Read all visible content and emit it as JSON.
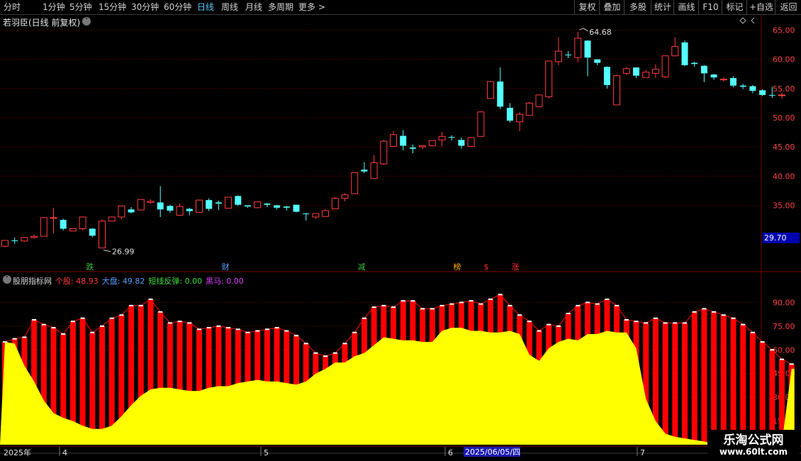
{
  "toolbar": {
    "periods": [
      {
        "label": "分时",
        "active": false
      },
      {
        "label": "1分钟",
        "active": false
      },
      {
        "label": "5分钟",
        "active": false
      },
      {
        "label": "15分钟",
        "active": false
      },
      {
        "label": "30分钟",
        "active": false
      },
      {
        "label": "60分钟",
        "active": false
      },
      {
        "label": "日线",
        "active": true
      },
      {
        "label": "周线",
        "active": false
      },
      {
        "label": "月线",
        "active": false
      },
      {
        "label": "多周期",
        "active": false
      },
      {
        "label": "更多 >",
        "active": false
      }
    ],
    "right_buttons": [
      "复权",
      "叠加",
      "多股",
      "统计",
      "画线",
      "F10",
      "标记",
      "+自选",
      "返回"
    ]
  },
  "main": {
    "title": "若羽臣(日线 前复权)",
    "high_label": "64.68",
    "low_label": "26.99",
    "current_price": "29.70",
    "price_axis": [
      "65.00",
      "60.00",
      "55.00",
      "50.00",
      "45.00",
      "40.00",
      "35.00"
    ]
  },
  "badges": [
    {
      "text": "跌",
      "color": "#3fbf3f"
    },
    {
      "text": "财",
      "color": "#5aa0ff"
    },
    {
      "text": "减",
      "color": "#3fbf3f"
    },
    {
      "text": "榜",
      "color": "#ffaa00"
    },
    {
      "text": "$",
      "color": "#ff3030"
    },
    {
      "text": "涨",
      "color": "#ff3030"
    }
  ],
  "indicator": {
    "name": "股朋指标网",
    "stock_label": "个股: ",
    "stock_value": "48.93",
    "market_label": "大盘: ",
    "market_value": "49.82",
    "rebound_label": "短线反弹: ",
    "rebound_value": "0.00",
    "darkhorse_label": "黑马: ",
    "darkhorse_value": "0.00",
    "axis": [
      "90.00",
      "75.00",
      "60.00",
      "45.00",
      "30.00",
      "15.00"
    ]
  },
  "date_axis": {
    "year": "2025年",
    "months": [
      "4",
      "5",
      "6",
      "7"
    ],
    "cursor_date": "2025/06/05/四"
  },
  "watermark": {
    "line1": "乐淘公式网",
    "line2": "www.60lt.com"
  },
  "colors": {
    "up": "#ff3c3c",
    "down": "#54ffff",
    "yellow": "#ffff00",
    "red": "#ff0000",
    "grid": "#7a0000"
  },
  "chart_data": {
    "type": "candlestick",
    "price_range": [
      24.5,
      67
    ],
    "candles": [
      [
        28.0,
        29.0,
        27.8,
        29.0
      ],
      [
        29.0,
        28.9,
        28.4,
        29.5
      ],
      [
        28.9,
        29.5,
        28.8,
        29.6
      ],
      [
        29.5,
        29.7,
        29.3,
        30.0
      ],
      [
        29.7,
        32.9,
        29.7,
        33.0
      ],
      [
        32.9,
        32.9,
        30.2,
        34.6
      ],
      [
        32.5,
        31.0,
        30.7,
        32.7
      ],
      [
        30.6,
        31.0,
        30.6,
        31.1
      ],
      [
        31.0,
        33.0,
        30.7,
        33.1
      ],
      [
        31.0,
        29.8,
        29.5,
        31.1
      ],
      [
        27.7,
        32.3,
        27.7,
        32.6
      ],
      [
        32.3,
        33.0,
        32.3,
        33.1
      ],
      [
        33.0,
        34.9,
        32.6,
        34.9
      ],
      [
        34.3,
        33.8,
        33.6,
        34.7
      ],
      [
        34.2,
        36.0,
        34.2,
        36.0
      ],
      [
        35.5,
        35.7,
        35.3,
        36.0
      ],
      [
        35.5,
        34.3,
        33.0,
        38.3
      ],
      [
        34.9,
        34.1,
        33.7,
        35.1
      ],
      [
        33.3,
        34.8,
        33.2,
        35.3
      ],
      [
        34.4,
        34.0,
        33.3,
        34.6
      ],
      [
        33.8,
        35.9,
        33.7,
        35.9
      ],
      [
        35.9,
        34.4,
        34.0,
        36.2
      ],
      [
        35.5,
        35.3,
        34.2,
        35.8
      ],
      [
        34.5,
        36.4,
        34.4,
        36.4
      ],
      [
        36.6,
        35.1,
        34.9,
        36.7
      ],
      [
        35.0,
        34.8,
        34.6,
        35.0
      ],
      [
        34.6,
        35.6,
        34.5,
        35.6
      ],
      [
        35.3,
        35.1,
        34.7,
        35.4
      ],
      [
        35.0,
        34.6,
        34.3,
        35.1
      ],
      [
        34.8,
        34.6,
        34.1,
        34.9
      ],
      [
        35.1,
        33.9,
        33.8,
        35.1
      ],
      [
        33.6,
        33.5,
        32.4,
        33.7
      ],
      [
        33.0,
        33.6,
        32.7,
        33.6
      ],
      [
        33.1,
        34.1,
        33.0,
        34.3
      ],
      [
        34.4,
        36.2,
        34.4,
        36.4
      ],
      [
        36.2,
        36.8,
        35.7,
        37.1
      ],
      [
        37.0,
        40.6,
        37.0,
        40.6
      ],
      [
        41.1,
        40.8,
        40.5,
        42.4
      ],
      [
        39.6,
        42.3,
        39.6,
        43.6
      ],
      [
        42.1,
        46.0,
        41.9,
        46.2
      ],
      [
        45.1,
        47.1,
        45.1,
        47.7
      ],
      [
        46.9,
        45.2,
        44.4,
        47.9
      ],
      [
        44.9,
        44.7,
        43.9,
        45.4
      ],
      [
        45.0,
        45.2,
        44.6,
        45.3
      ],
      [
        45.2,
        46.1,
        45.2,
        46.1
      ],
      [
        46.2,
        46.8,
        45.1,
        47.6
      ],
      [
        46.7,
        46.6,
        46.1,
        47.0
      ],
      [
        46.2,
        45.2,
        44.7,
        46.6
      ],
      [
        45.1,
        46.6,
        45.1,
        46.7
      ],
      [
        46.8,
        51.0,
        46.8,
        51.1
      ],
      [
        53.3,
        56.2,
        53.3,
        56.2
      ],
      [
        56.2,
        51.9,
        51.5,
        58.6
      ],
      [
        51.7,
        49.5,
        49.2,
        52.5
      ],
      [
        49.3,
        50.6,
        47.7,
        51.0
      ],
      [
        50.4,
        52.5,
        50.4,
        52.7
      ],
      [
        51.9,
        53.9,
        51.8,
        53.9
      ],
      [
        53.6,
        59.7,
        53.3,
        59.7
      ],
      [
        59.6,
        61.4,
        59.0,
        63.8
      ],
      [
        60.8,
        60.7,
        60.2,
        61.4
      ],
      [
        60.3,
        63.6,
        59.5,
        64.7
      ],
      [
        63.2,
        60.3,
        57.1,
        63.3
      ],
      [
        60.0,
        59.4,
        59.0,
        60.0
      ],
      [
        58.7,
        55.6,
        55.0,
        58.8
      ],
      [
        52.2,
        57.2,
        52.2,
        57.4
      ],
      [
        57.6,
        58.4,
        57.3,
        58.7
      ],
      [
        58.6,
        57.2,
        56.8,
        58.6
      ],
      [
        56.9,
        57.8,
        56.9,
        58.2
      ],
      [
        57.6,
        58.3,
        56.8,
        59.2
      ],
      [
        57.0,
        60.6,
        56.8,
        60.6
      ],
      [
        60.6,
        62.2,
        60.5,
        63.8
      ],
      [
        62.9,
        59.0,
        58.8,
        63.2
      ],
      [
        59.4,
        59.2,
        58.7,
        59.6
      ],
      [
        58.9,
        57.6,
        56.1,
        59.0
      ],
      [
        57.4,
        56.9,
        56.5,
        57.5
      ],
      [
        56.6,
        56.6,
        56.2,
        56.9
      ],
      [
        56.8,
        55.5,
        55.2,
        57.1
      ],
      [
        55.5,
        55.3,
        54.9,
        55.8
      ],
      [
        55.4,
        54.6,
        54.2,
        55.6
      ],
      [
        54.7,
        53.9,
        53.7,
        54.9
      ],
      [
        53.9,
        53.8,
        53.4,
        55.3
      ],
      [
        53.8,
        53.9,
        53.3,
        54.3
      ]
    ],
    "indicator_stock": [
      65,
      67,
      68,
      79,
      76,
      74,
      70,
      78,
      80,
      71,
      75,
      80,
      82,
      88,
      88,
      92,
      84,
      77,
      78,
      77,
      73,
      74,
      75,
      74,
      73,
      71,
      72,
      73,
      74,
      72,
      69,
      64,
      58,
      56,
      58,
      64,
      71,
      80,
      87,
      88,
      87,
      91,
      91,
      86,
      86,
      88,
      89,
      90,
      91,
      89,
      92,
      95,
      88,
      82,
      78,
      72,
      76,
      75,
      83,
      88,
      90,
      89,
      92,
      88,
      79,
      78,
      77,
      80,
      77,
      77,
      77,
      84,
      86,
      84,
      82,
      80,
      76,
      71,
      65,
      60,
      54,
      51
    ],
    "indicator_market": [
      65,
      64,
      50,
      40,
      28,
      20,
      17,
      15,
      12,
      10,
      10,
      12,
      18,
      25,
      31,
      35,
      36,
      36,
      35,
      34,
      34,
      36,
      37,
      37,
      39,
      40,
      41,
      40,
      40,
      39,
      38,
      40,
      45,
      48,
      52,
      52,
      56,
      58,
      63,
      68,
      67,
      66,
      66,
      65,
      65,
      72,
      74,
      74,
      72,
      72,
      71,
      71,
      72,
      70,
      57,
      53,
      61,
      65,
      67,
      66,
      70,
      70,
      72,
      71,
      71,
      61,
      29,
      15,
      7,
      5,
      4,
      3,
      2,
      1,
      1,
      1,
      1,
      1,
      1,
      1,
      1,
      48
    ]
  }
}
